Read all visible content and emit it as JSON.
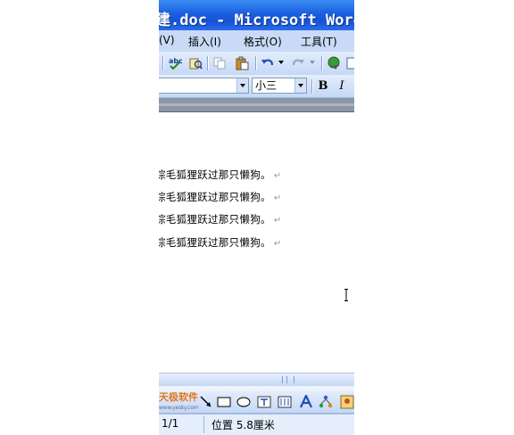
{
  "window": {
    "title": "建.doc - Microsoft Word"
  },
  "menu": {
    "items": [
      {
        "label": "(V)"
      },
      {
        "label": "插入(I)"
      },
      {
        "label": "格式(O)"
      },
      {
        "label": "工具(T)"
      }
    ]
  },
  "formatting": {
    "font_size": "小三",
    "bold_label": "B",
    "italic_label": "I"
  },
  "document": {
    "lines": [
      "棕毛狐狸跃过那只懒狗。",
      "棕毛狐狸跃过那只懒狗。",
      "棕毛狐狸跃过那只懒狗。",
      "棕毛狐狸跃过那只懒狗。"
    ],
    "paragraph_mark": "↵"
  },
  "drawing_toolbar": {
    "logo_text": "天极软件",
    "logo_sub": "www.yesky.com"
  },
  "statusbar": {
    "page": "1/1",
    "position": "位置 5.8厘米"
  },
  "colors": {
    "titlebar": "#1a5fe0",
    "toolbar": "#c9daf6",
    "ruler": "#8c96a4",
    "logo": "#e4761b"
  }
}
